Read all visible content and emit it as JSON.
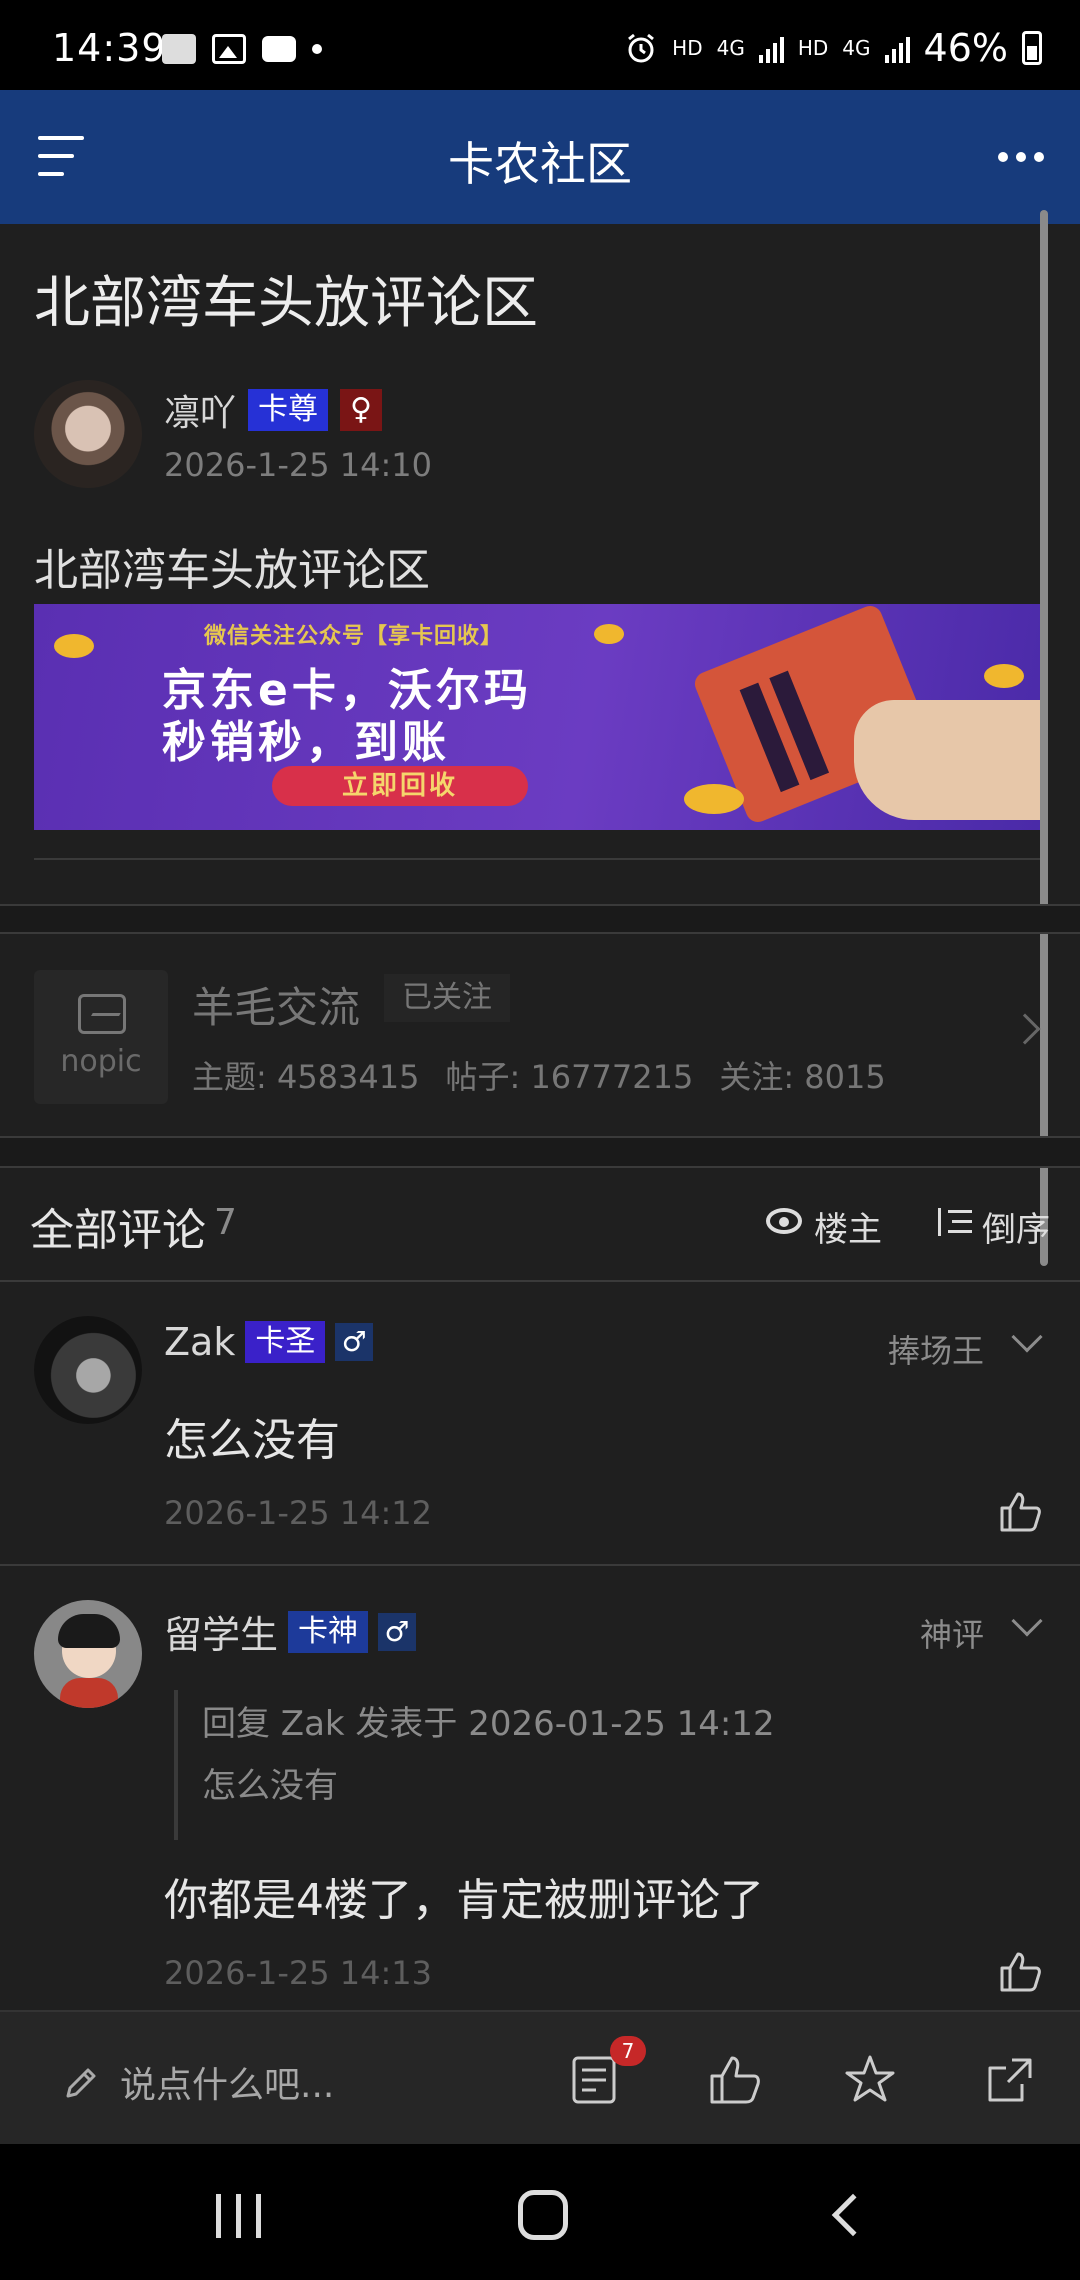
{
  "status_bar": {
    "time": "14:39",
    "battery": "46%",
    "network_left": "HD",
    "network_left_type": "4G",
    "network_right": "HD",
    "network_right_type": "4G"
  },
  "header": {
    "title": "卡农社区"
  },
  "post": {
    "title": "北部湾车头放评论区",
    "author": {
      "name": "凛吖",
      "rank": "卡尊",
      "gender_symbol": "♀"
    },
    "time": "2026-1-25 14:10",
    "body": "北部湾车头放评论区",
    "banner": {
      "top_text": "微信关注公众号【享卡回收】",
      "line1": "京东e卡，沃尔玛",
      "line2": "秒销秒，到账",
      "cta": "立即回收"
    }
  },
  "forum": {
    "placeholder_text": "nopic",
    "name": "羊毛交流",
    "follow_label": "已关注",
    "stats": {
      "topics": "主题: 4583415",
      "posts": "帖子: 16777215",
      "followers": "关注: 8015"
    }
  },
  "comments_header": {
    "title": "全部评论",
    "count": "7",
    "op_only_label": "楼主",
    "sort_label": "倒序"
  },
  "comments": [
    {
      "name": "Zak",
      "rank": "卡圣",
      "gender_symbol": "♂",
      "tag": "捧场王",
      "text": "怎么没有",
      "time": "2026-1-25 14:12"
    },
    {
      "name": "留学生",
      "rank": "卡神",
      "gender_symbol": "♂",
      "tag": "神评",
      "quote_header": "回复 Zak 发表于 2026-01-25 14:12",
      "quote_text": "怎么没有",
      "text": "你都是4楼了，肯定被删评论了",
      "time": "2026-1-25 14:13"
    }
  ],
  "action_bar": {
    "input_placeholder": "说点什么吧...",
    "comment_badge": "7"
  },
  "colors": {
    "header_bg": "#173b7c",
    "background": "#1f1f1f",
    "badge_red": "#c62828"
  },
  "icons": [
    "menu-icon",
    "more-icon",
    "eye-icon",
    "sort-icon",
    "thumbs-up-icon",
    "comments-icon",
    "star-icon",
    "share-icon",
    "pencil-icon",
    "chevron-right-icon",
    "chevron-down-icon"
  ]
}
